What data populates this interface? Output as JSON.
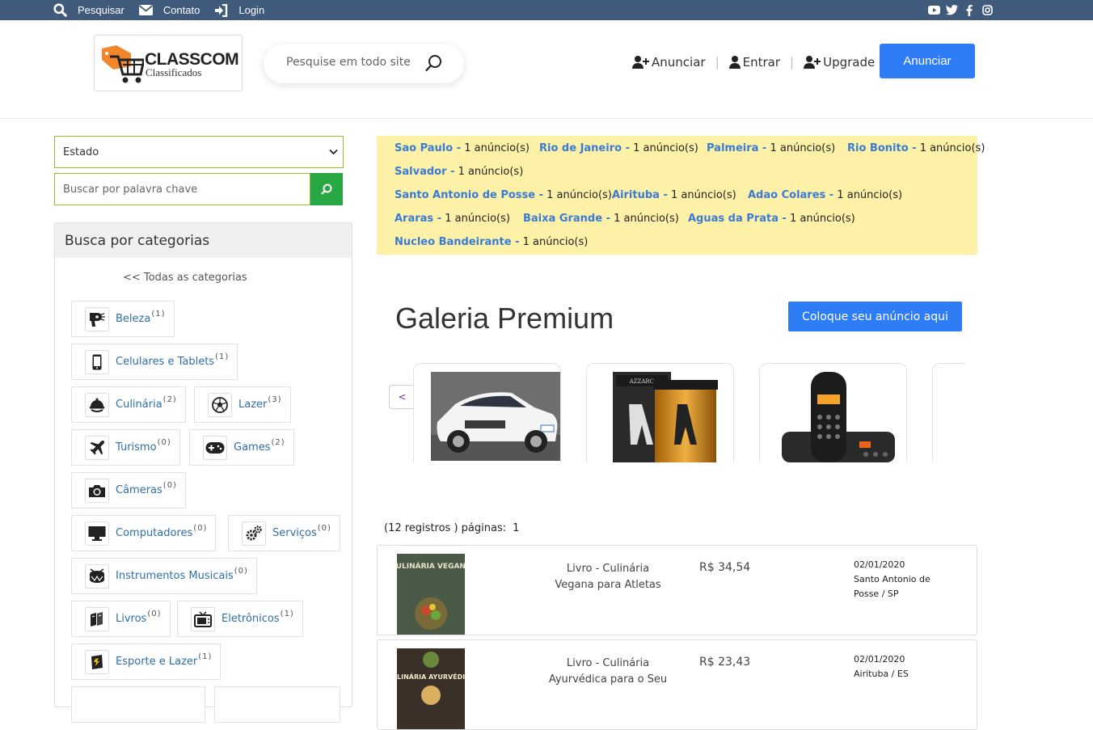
{
  "topbar": {
    "items": [
      {
        "label": "Pesquisar",
        "icon": "search-icon"
      },
      {
        "label": "Contato",
        "icon": "envelope-icon"
      },
      {
        "label": "Login",
        "icon": "sign-in-icon"
      }
    ],
    "social": [
      "youtube-icon",
      "twitter-icon",
      "facebook-icon",
      "instagram-icon"
    ]
  },
  "header": {
    "logo_title": "CLASSCOM",
    "logo_subtitle": "Classificados",
    "search_placeholder": "Pesquise em todo site",
    "nav": [
      {
        "label": "Anunciar",
        "icon": "user-plus-icon"
      },
      {
        "label": "Entrar",
        "icon": "user-icon"
      },
      {
        "label": "Upgrade",
        "icon": "user-plus-icon"
      }
    ],
    "cta_label": "Anunciar"
  },
  "sidebar": {
    "state_select": "Estado",
    "keyword_placeholder": "Buscar por palavra chave",
    "categories_title": "Busca por categorias",
    "all_categories": "<< Todas as categorias",
    "categories": [
      {
        "label": "Beleza",
        "count": "(1)",
        "icon": "hair-dryer-icon"
      },
      {
        "label": "Celulares e Tablets",
        "count": "(1)",
        "icon": "mobile-phone-icon"
      },
      {
        "label": "Culinária",
        "count": "(2)",
        "icon": "chef-hat-icon"
      },
      {
        "label": "Lazer",
        "count": "(3)",
        "icon": "soccer-ball-icon"
      },
      {
        "label": "Turismo",
        "count": "(0)",
        "icon": "airplane-icon"
      },
      {
        "label": "Games",
        "count": "(2)",
        "icon": "gamepad-icon"
      },
      {
        "label": "Câmeras",
        "count": "(0)",
        "icon": "camera-icon"
      },
      {
        "label": "Computadores",
        "count": "(0)",
        "icon": "monitor-icon"
      },
      {
        "label": "Serviços",
        "count": "(0)",
        "icon": "gears-icon"
      },
      {
        "label": "Instrumentos Musicais",
        "count": "(0)",
        "icon": "drum-icon"
      },
      {
        "label": "Livros",
        "count": "(0)",
        "icon": "books-icon"
      },
      {
        "label": "Eletrônicos",
        "count": "(1)",
        "icon": "tv-icon"
      },
      {
        "label": "Esporte e Lazer",
        "count": "(1)",
        "icon": "book-icon"
      }
    ]
  },
  "locations": [
    {
      "name": "Sao Paulo -",
      "count": "1 anúncio(s)"
    },
    {
      "name": "Rio de Janeiro -",
      "count": "1 anúncio(s)"
    },
    {
      "name": "Palmeira -",
      "count": "1 anúncio(s)"
    },
    {
      "name": "Rio Bonito -",
      "count": "1 anúncio(s)"
    },
    {
      "name": "Salvador -",
      "count": "1 anúncio(s)"
    },
    {
      "name": "Santo Antonio de Posse -",
      "count": "1 anúncio(s)"
    },
    {
      "name": "Airituba -",
      "count": "1 anúncio(s)"
    },
    {
      "name": "Adao Colares -",
      "count": "1 anúncio(s)"
    },
    {
      "name": "Araras -",
      "count": "1 anúncio(s)"
    },
    {
      "name": "Baixa Grande -",
      "count": "1 anúncio(s)"
    },
    {
      "name": "Aguas da Prata -",
      "count": "1 anúncio(s)"
    },
    {
      "name": "Nucleo Bandeirante -",
      "count": "1 anúncio(s)"
    }
  ],
  "gallery": {
    "title": "Galeria Premium",
    "cta_label": "Coloque seu anúncio aqui",
    "prev": "<",
    "next": ">",
    "items": [
      "car-photo",
      "perfume-photo",
      "phone-photo"
    ]
  },
  "listing": {
    "records": "(12 registros ) páginas:",
    "page": "1",
    "rows": [
      {
        "title": "Livro - Culinária Vegana para Atletas",
        "price": "R$ 34,54",
        "date": "02/01/2020",
        "location": "Santo Antonio de Posse / SP",
        "cover": "CULINÁRIA VEGANA"
      },
      {
        "title": "Livro - Culinária Ayurvédica para o Seu",
        "price": "R$ 23,43",
        "date": "02/01/2020",
        "location": "Airituba / ES",
        "cover": "CULINÁRIA AYURVÉDICA"
      }
    ]
  }
}
